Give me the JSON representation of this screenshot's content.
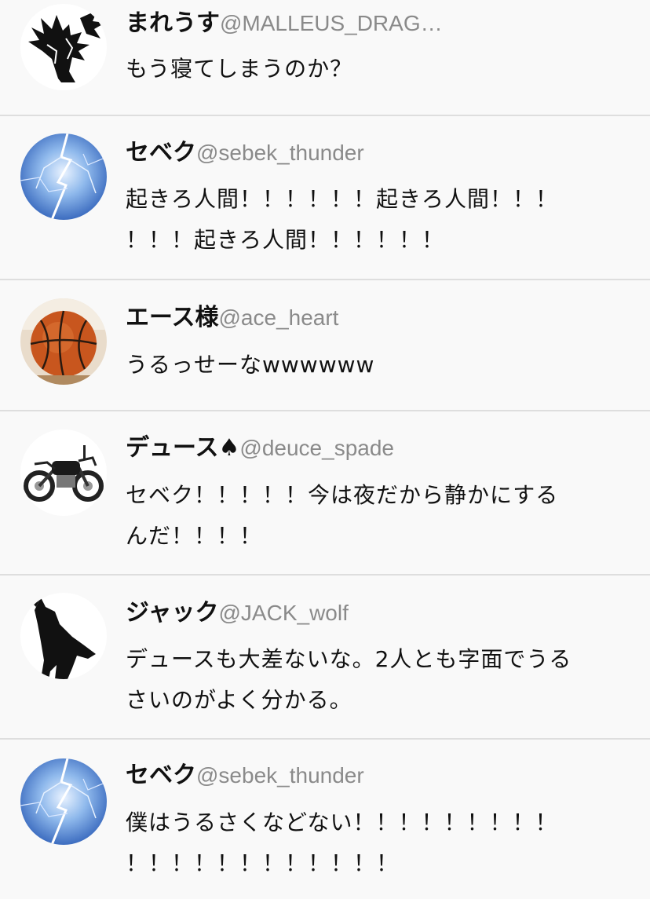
{
  "tweets": [
    {
      "name": "まれうす",
      "handle": "@MALLEUS_DRAG…",
      "lines": [
        "もう寝てしまうのか？"
      ],
      "avatar": "dragon-avatar-icon"
    },
    {
      "name": "セベク",
      "handle": "@sebek_thunder",
      "lines": [
        "起きろ人間！！！！！！起きろ人間！！！",
        "！！！起きろ人間！！！！！！"
      ],
      "avatar": "lightning-avatar-icon"
    },
    {
      "name": "エース様",
      "handle": "@ace_heart",
      "lines": [
        "うるっせーなwwwwww"
      ],
      "avatar": "basketball-avatar-icon"
    },
    {
      "name": "デュース♠",
      "handle": "@deuce_spade",
      "lines": [
        "セベク！！！！！今は夜だから静かにする",
        "んだ！！！！"
      ],
      "avatar": "motorcycle-avatar-icon"
    },
    {
      "name": "ジャック",
      "handle": "@JACK_wolf",
      "lines": [
        "デュースも大差ないな。2人とも字面でうる",
        "さいのがよく分かる。"
      ],
      "avatar": "wolf-avatar-icon"
    },
    {
      "name": "セベク",
      "handle": "@sebek_thunder",
      "lines": [
        "僕はうるさくなどない！！！！！！！！！",
        "！！！！！！！！！！！！"
      ],
      "avatar": "lightning-avatar-icon"
    }
  ]
}
